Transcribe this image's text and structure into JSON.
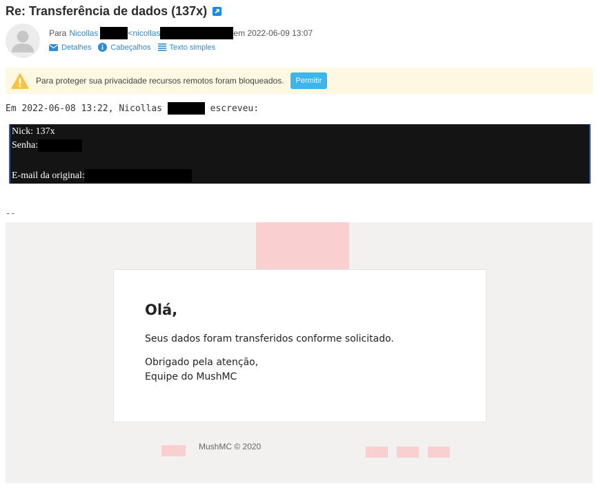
{
  "subject": "Re: Transferência de dados (137x)",
  "header": {
    "to_label": "Para",
    "to_name": "Nicollas",
    "to_email_prefix": "<nicollas",
    "date": "em 2022-06-09 13:07",
    "links": {
      "details": "Detalhes",
      "headers": "Cabeçalhos",
      "plain_text": "Texto simples"
    }
  },
  "warning": {
    "text": "Para proteger sua privacidade recursos remotos foram bloqueados.",
    "allow_button": "Permitir"
  },
  "quote": {
    "intro_before": "Em 2022-06-08 13:22, Nicollas ",
    "intro_after": " escreveu:",
    "nick_line": "Nick: 137x",
    "password_label": "Senha:",
    "original_email_label": "E-mail da original:"
  },
  "signature_sep": "--",
  "email_body": {
    "greeting": "Olá,",
    "line1": "Seus dados foram transferidos conforme solicitado.",
    "thanks": "Obrigado pela atenção,",
    "team": "Equipe do MushMC",
    "copyright": "MushMC © 2020"
  },
  "colors": {
    "accent": "#2a8bd6",
    "allow_button": "#3cb4ec",
    "warning_bg": "#fdf8e1",
    "panel_bg": "#f2f1ef",
    "image_placeholder": "#f9cfcf"
  },
  "icons": [
    "external-link-icon",
    "envelope-icon",
    "info-icon",
    "list-icon",
    "warning-icon",
    "avatar-icon"
  ]
}
